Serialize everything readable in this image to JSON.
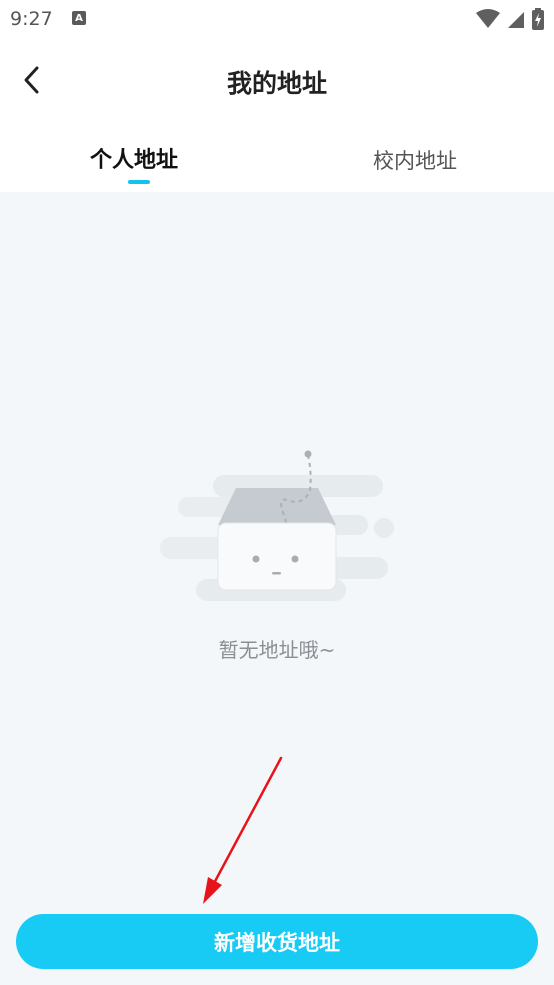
{
  "status_bar": {
    "time": "9:27",
    "notification_glyph": "A"
  },
  "header": {
    "title": "我的地址"
  },
  "tabs": [
    {
      "label": "个人地址",
      "active": true
    },
    {
      "label": "校内地址",
      "active": false
    }
  ],
  "empty_state": {
    "message": "暂无地址哦~"
  },
  "actions": {
    "add_address_label": "新增收货地址"
  },
  "colors": {
    "accent": "#17cbf5",
    "background": "#f4f7f9",
    "annotation": "#e8121a"
  }
}
